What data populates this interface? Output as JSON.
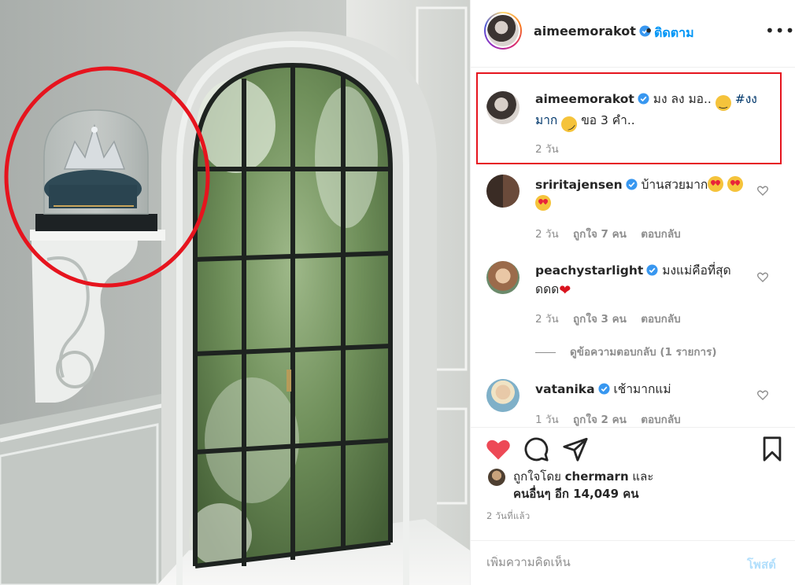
{
  "post_author": {
    "username": "aimeemorakot",
    "follow_label": "ติดตาม",
    "dot": "•",
    "more": "•••"
  },
  "caption": {
    "username": "aimeemorakot",
    "text_1": "มง ลง มอ..",
    "hashtag": "#งง",
    "hashtag_2": "มาก",
    "text_2": "ขอ 3 คำ..",
    "time": "2 วัน"
  },
  "comments": [
    {
      "username": "sriritajensen",
      "text": "บ้านสวยมาก",
      "time": "2 วัน",
      "likes": "ถูกใจ 7 คน",
      "reply": "ตอบกลับ"
    },
    {
      "username": "peachystarlight",
      "text": "มงแม่คือที่สุด",
      "text_2": "ดดด",
      "time": "2 วัน",
      "likes": "ถูกใจ 3 คน",
      "reply": "ตอบกลับ"
    },
    {
      "username": "vatanika",
      "text": "เช้ามากแม่",
      "time": "1 วัน",
      "likes": "ถูกใจ 2 คน",
      "reply": "ตอบกลับ"
    }
  ],
  "view_replies": "ดูข้อความตอบกลับ (1 รายการ)",
  "likes_summary": {
    "prefix": "ถูกใจโดย",
    "user": "chermarn",
    "and": "และ",
    "others": "คนอื่นๆ อีก 14,049 คน"
  },
  "posted_ago": "2 วันที่แล้ว",
  "add_comment": {
    "placeholder": "เพิ่มความคิดเห็น",
    "post_label": "โพสต์"
  },
  "icons": {
    "like": "heart-filled-icon",
    "comment": "comment-icon",
    "share": "paper-plane-icon",
    "save": "bookmark-icon",
    "verified": "verified-badge-icon"
  },
  "colors": {
    "like_red": "#ed4956",
    "link_blue": "#0095f6",
    "verified_blue": "#3897f0",
    "highlight_red": "#e6141e"
  }
}
